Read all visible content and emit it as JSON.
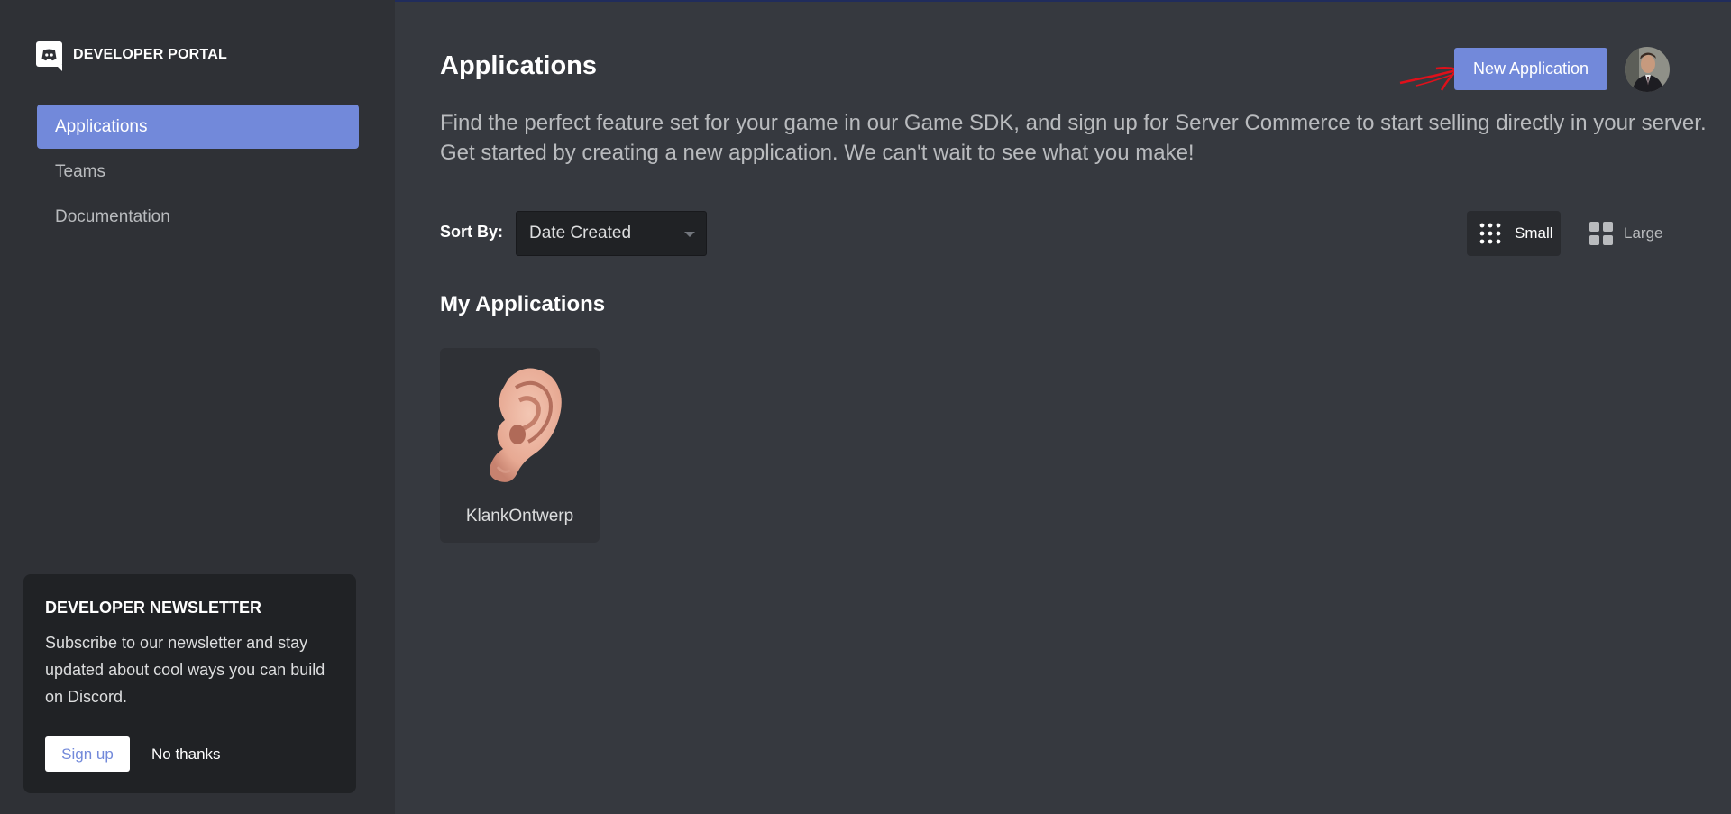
{
  "brand": {
    "label": "DEVELOPER PORTAL",
    "icon": "discord-logo-icon"
  },
  "sidebar": {
    "items": [
      {
        "label": "Applications",
        "active": true
      },
      {
        "label": "Teams",
        "active": false
      },
      {
        "label": "Documentation",
        "active": false
      }
    ]
  },
  "newsletter": {
    "title": "DEVELOPER NEWSLETTER",
    "body": "Subscribe to our newsletter and stay updated about cool ways you can build on Discord.",
    "signup_label": "Sign up",
    "dismiss_label": "No thanks"
  },
  "header": {
    "title": "Applications",
    "new_app_label": "New Application",
    "intro": "Find the perfect feature set for your game in our Game SDK, and sign up for Server Commerce to start selling directly in your server. Get started by creating a new application. We can't wait to see what you make!"
  },
  "sort": {
    "label": "Sort By:",
    "value": "Date Created"
  },
  "view_toggle": {
    "small_label": "Small",
    "large_label": "Large",
    "selected": "Small"
  },
  "my_apps": {
    "title": "My Applications",
    "apps": [
      {
        "name": "KlankOntwerp",
        "icon": "ear-icon"
      }
    ]
  },
  "colors": {
    "accent": "#7289da",
    "background": "#36393f",
    "sidebar": "#2f3136",
    "annotation": "#e0101a"
  }
}
